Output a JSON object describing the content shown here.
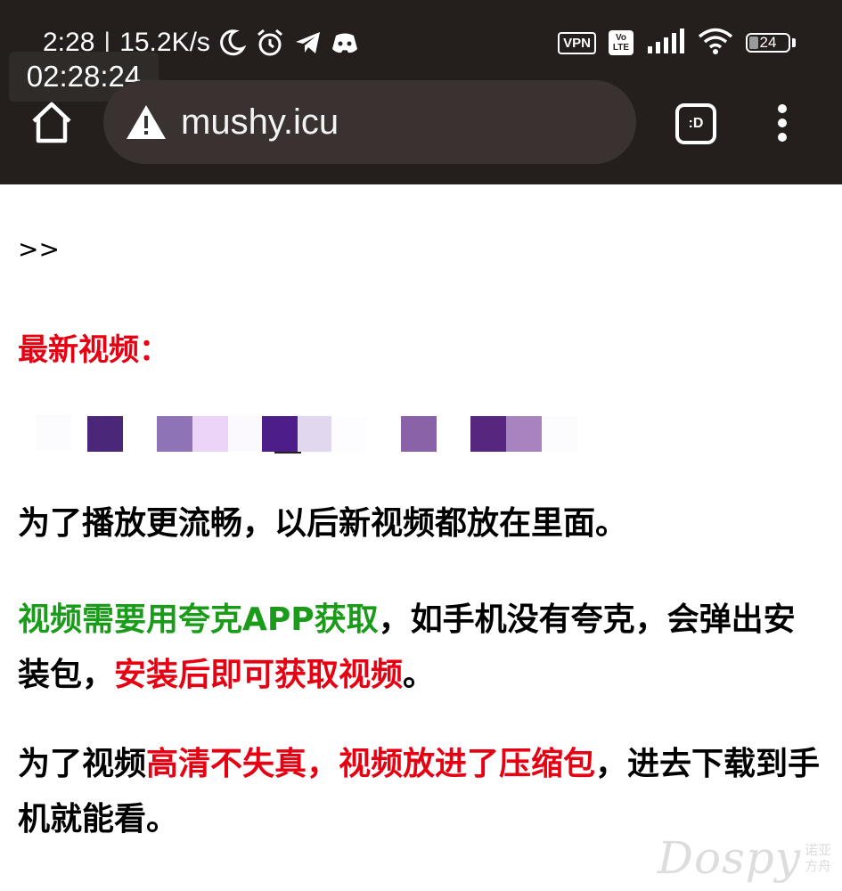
{
  "status_bar": {
    "time": "2:28",
    "separator": "|",
    "speed": "15.2K/s",
    "icons": [
      "moon-icon",
      "alarm-icon",
      "telegram-icon",
      "discord-icon",
      "vpn-badge",
      "volte-badge",
      "signal-icon",
      "wifi-icon",
      "battery-icon"
    ],
    "vpn_label": "VPN",
    "volte_top": "Vo",
    "volte_bottom": "LTE",
    "battery_level": "24"
  },
  "overlay_clock": "02:28:24",
  "browser": {
    "url": "mushy.icu",
    "tab_button_label": ":D",
    "security_icon": "warning-icon"
  },
  "page": {
    "prompt": ">>",
    "heading": "最新视频：",
    "paragraph1": "为了播放更流畅，以后新视频都放在里面。",
    "paragraph2": {
      "green": "视频需要用夸克APP获取",
      "black1": "，如手机没有夸克，会弹出安装包，",
      "red": "安装后即可获取视频",
      "black2": "。"
    },
    "paragraph3": {
      "black1": "为了视频",
      "red": "高清不失真，视频放进了压缩包",
      "black2": "，进去下载到手机就能看。"
    }
  },
  "watermark": {
    "main": "Dospy",
    "sub_line1": "诺亚",
    "sub_line2": "方舟"
  },
  "colors": {
    "browser_bar": "#241e1c",
    "url_field": "#3a3230",
    "red_text": "#e60012",
    "green_text": "#1a9b1a"
  }
}
